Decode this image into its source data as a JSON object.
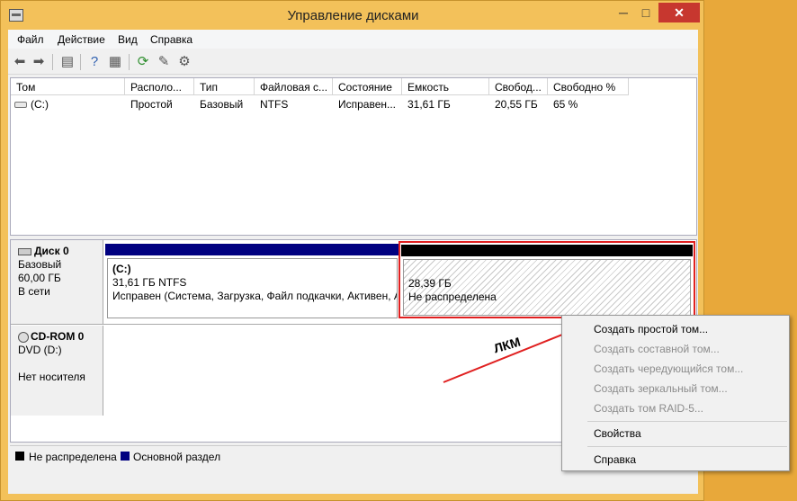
{
  "window": {
    "title": "Управление дисками",
    "minimize": "─",
    "maximize": "□",
    "close": "✕"
  },
  "menu": [
    "Файл",
    "Действие",
    "Вид",
    "Справка"
  ],
  "toolbar_icons": [
    "back-icon",
    "forward-icon",
    "console-tree-icon",
    "help-icon",
    "export-icon",
    "refresh-icon",
    "properties-icon",
    "settings-icon"
  ],
  "volume_table": {
    "columns": [
      "Том",
      "Располо...",
      "Тип",
      "Файловая с...",
      "Состояние",
      "Емкость",
      "Свобод...",
      "Свободно %"
    ],
    "rows": [
      {
        "tom": "(C:)",
        "layout": "Простой",
        "type": "Базовый",
        "fs": "NTFS",
        "status": "Исправен...",
        "capacity": "31,61 ГБ",
        "free": "20,55 ГБ",
        "free_pct": "65 %"
      }
    ]
  },
  "disks": [
    {
      "name": "Диск 0",
      "kind": "Базовый",
      "size": "60,00 ГБ",
      "state": "В сети",
      "partitions": [
        {
          "title": "(C:)",
          "size_fs": "31,61 ГБ NTFS",
          "status": "Исправен (Система, Загрузка, Файл подкачки, Активен, А"
        },
        {
          "size": "28,39 ГБ",
          "status": "Не распределена"
        }
      ]
    },
    {
      "name": "CD-ROM 0",
      "kind": "DVD (D:)",
      "state": "Нет носителя"
    }
  ],
  "legend": [
    {
      "label": "Не распределена",
      "color": "#000000"
    },
    {
      "label": "Основной раздел",
      "color": "#000080"
    }
  ],
  "context_menu": {
    "items": [
      {
        "label": "Создать простой том...",
        "enabled": true
      },
      {
        "label": "Создать составной том...",
        "enabled": false
      },
      {
        "label": "Создать чередующийся том...",
        "enabled": false
      },
      {
        "label": "Создать зеркальный том...",
        "enabled": false
      },
      {
        "label": "Создать том RAID-5...",
        "enabled": false
      },
      {
        "label": "Свойства",
        "enabled": true
      },
      {
        "label": "Справка",
        "enabled": true
      }
    ]
  },
  "annotation": {
    "label": "ЛКМ",
    "color": "#e02020"
  },
  "colors": {
    "primary_partition": "#000080",
    "unallocated": "#000000",
    "highlight": "#e02020",
    "window_frame": "#f3c15a"
  }
}
